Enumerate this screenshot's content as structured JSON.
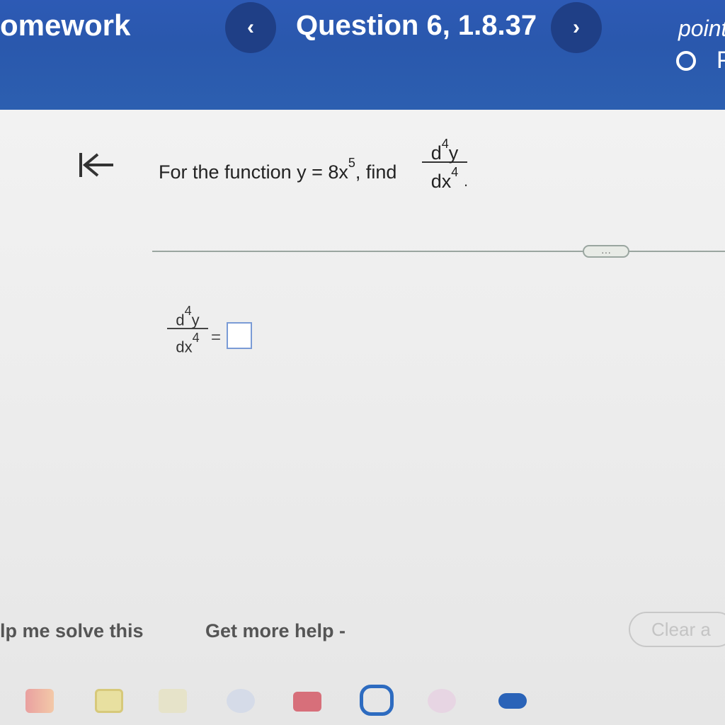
{
  "header": {
    "title": "omework",
    "prev_label": "‹",
    "question_label": "Question 6, 1.8.37",
    "next_label": "›",
    "points_label": "point",
    "status_letter": "P"
  },
  "question": {
    "prompt_prefix": "For the function y = 8x",
    "prompt_exponent": "5",
    "prompt_suffix": ", find",
    "frac_num_d": "d",
    "frac_num_exp": "4",
    "frac_num_var": "y",
    "frac_den_var": "dx",
    "frac_den_exp": "4",
    "period": "."
  },
  "more_button": {
    "label": "···"
  },
  "answer": {
    "num_d": "d",
    "num_exp": "4",
    "num_var": "y",
    "den_var": "dx",
    "den_exp": "4",
    "equals": "=",
    "value": ""
  },
  "footer": {
    "help_solve": "lp me solve this",
    "get_help": "Get more help -",
    "clear": "Clear a"
  },
  "dock": {
    "icons": [
      "gmail-icon",
      "classroom-icon",
      "docs-icon",
      "play-icon",
      "youtube-icon",
      "launcher-icon",
      "photos-icon",
      "meet-icon"
    ]
  },
  "colors": {
    "header_blue": "#2d5ab5",
    "nav_button": "#1f3f86",
    "input_border": "#7a9bd6"
  }
}
